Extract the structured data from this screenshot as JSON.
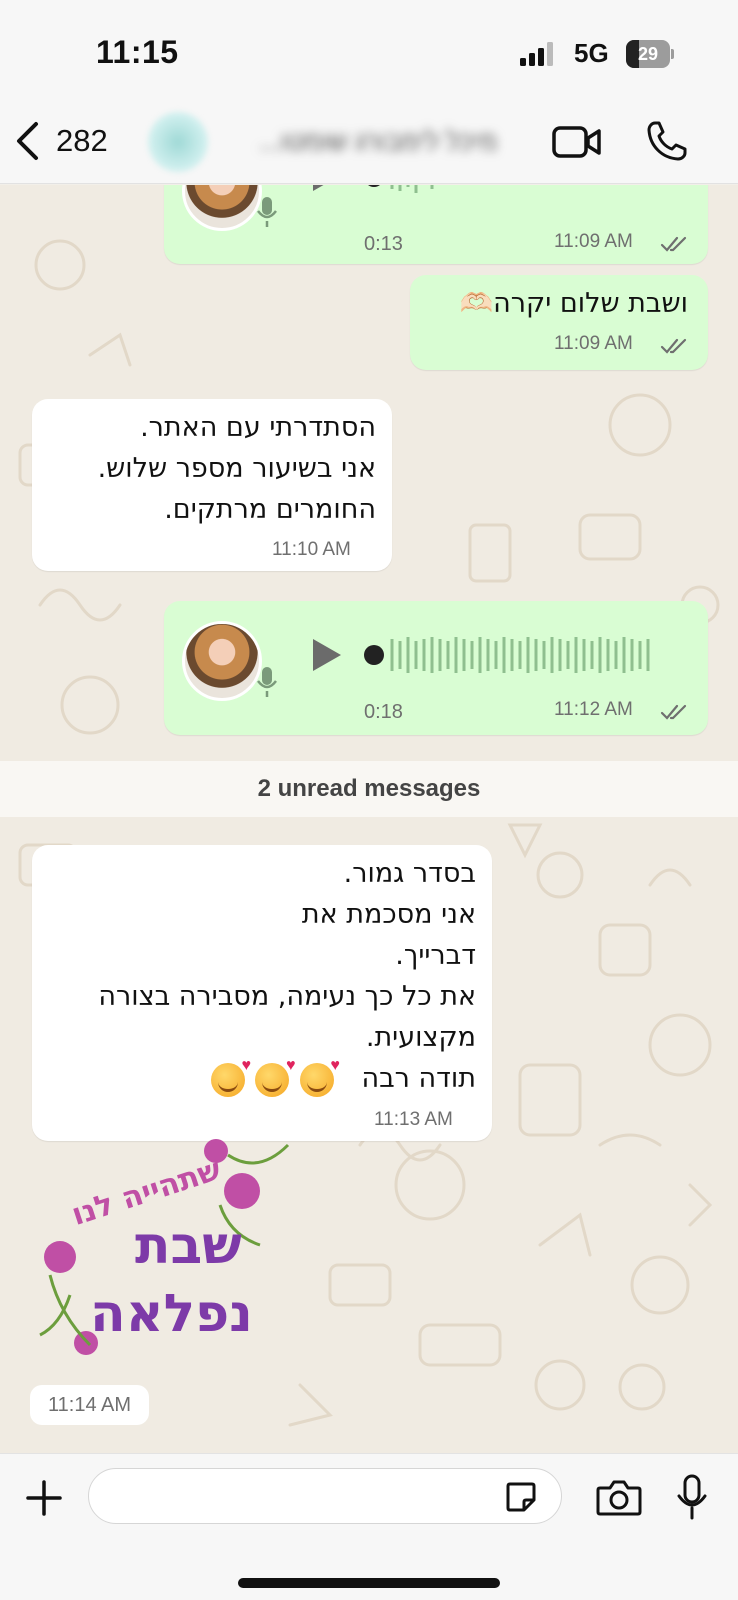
{
  "status_bar": {
    "time": "11:15",
    "network": "5G",
    "battery_level": "29",
    "battery_fraction": 0.29
  },
  "header": {
    "back_count": "282",
    "contact_name": "מיכל לימבורג שומטו...",
    "icons": [
      "chevron-left-icon",
      "video-camera-icon",
      "phone-icon"
    ]
  },
  "messages": [
    {
      "type": "voice",
      "direction": "out",
      "duration": "0:13",
      "time": "11:09 AM",
      "status": "read"
    },
    {
      "type": "text",
      "direction": "out",
      "text": "ושבת שלום יקרה🫶🏻",
      "time": "11:09 AM",
      "status": "read"
    },
    {
      "type": "text",
      "direction": "in",
      "text": "הסתדרתי עם האתר.\nאני בשיעור מספר שלוש.\nהחומרים מרתקים.",
      "time": "11:10 AM"
    },
    {
      "type": "voice",
      "direction": "out",
      "duration": "0:18",
      "time": "11:12 AM",
      "status": "read"
    },
    {
      "type": "text",
      "direction": "in",
      "text": "בסדר גמור.\nאני מסכמת את\nדברייך.\nאת כל כך נעימה, מסבירה בצורה\nמקצועית.\nתודה רבה",
      "emoji_count": 3,
      "emoji": "smiling-face-with-hearts",
      "time": "11:13 AM"
    },
    {
      "type": "sticker",
      "direction": "in",
      "sticker_text": [
        "שתהייה לנו",
        "שבת",
        "נפלאה"
      ],
      "time": "11:14 AM"
    }
  ],
  "unread_banner": "2 unread messages",
  "input_bar": {
    "placeholder": "",
    "icons": [
      "plus-icon",
      "sticker-icon",
      "camera-icon",
      "microphone-icon"
    ]
  },
  "colors": {
    "outgoing_bubble": "#d9fdd3",
    "incoming_bubble": "#ffffff",
    "wallpaper": "#f0ebe2",
    "sticker_purple": "#7d3aa8",
    "sticker_pink": "#c04fa5"
  }
}
